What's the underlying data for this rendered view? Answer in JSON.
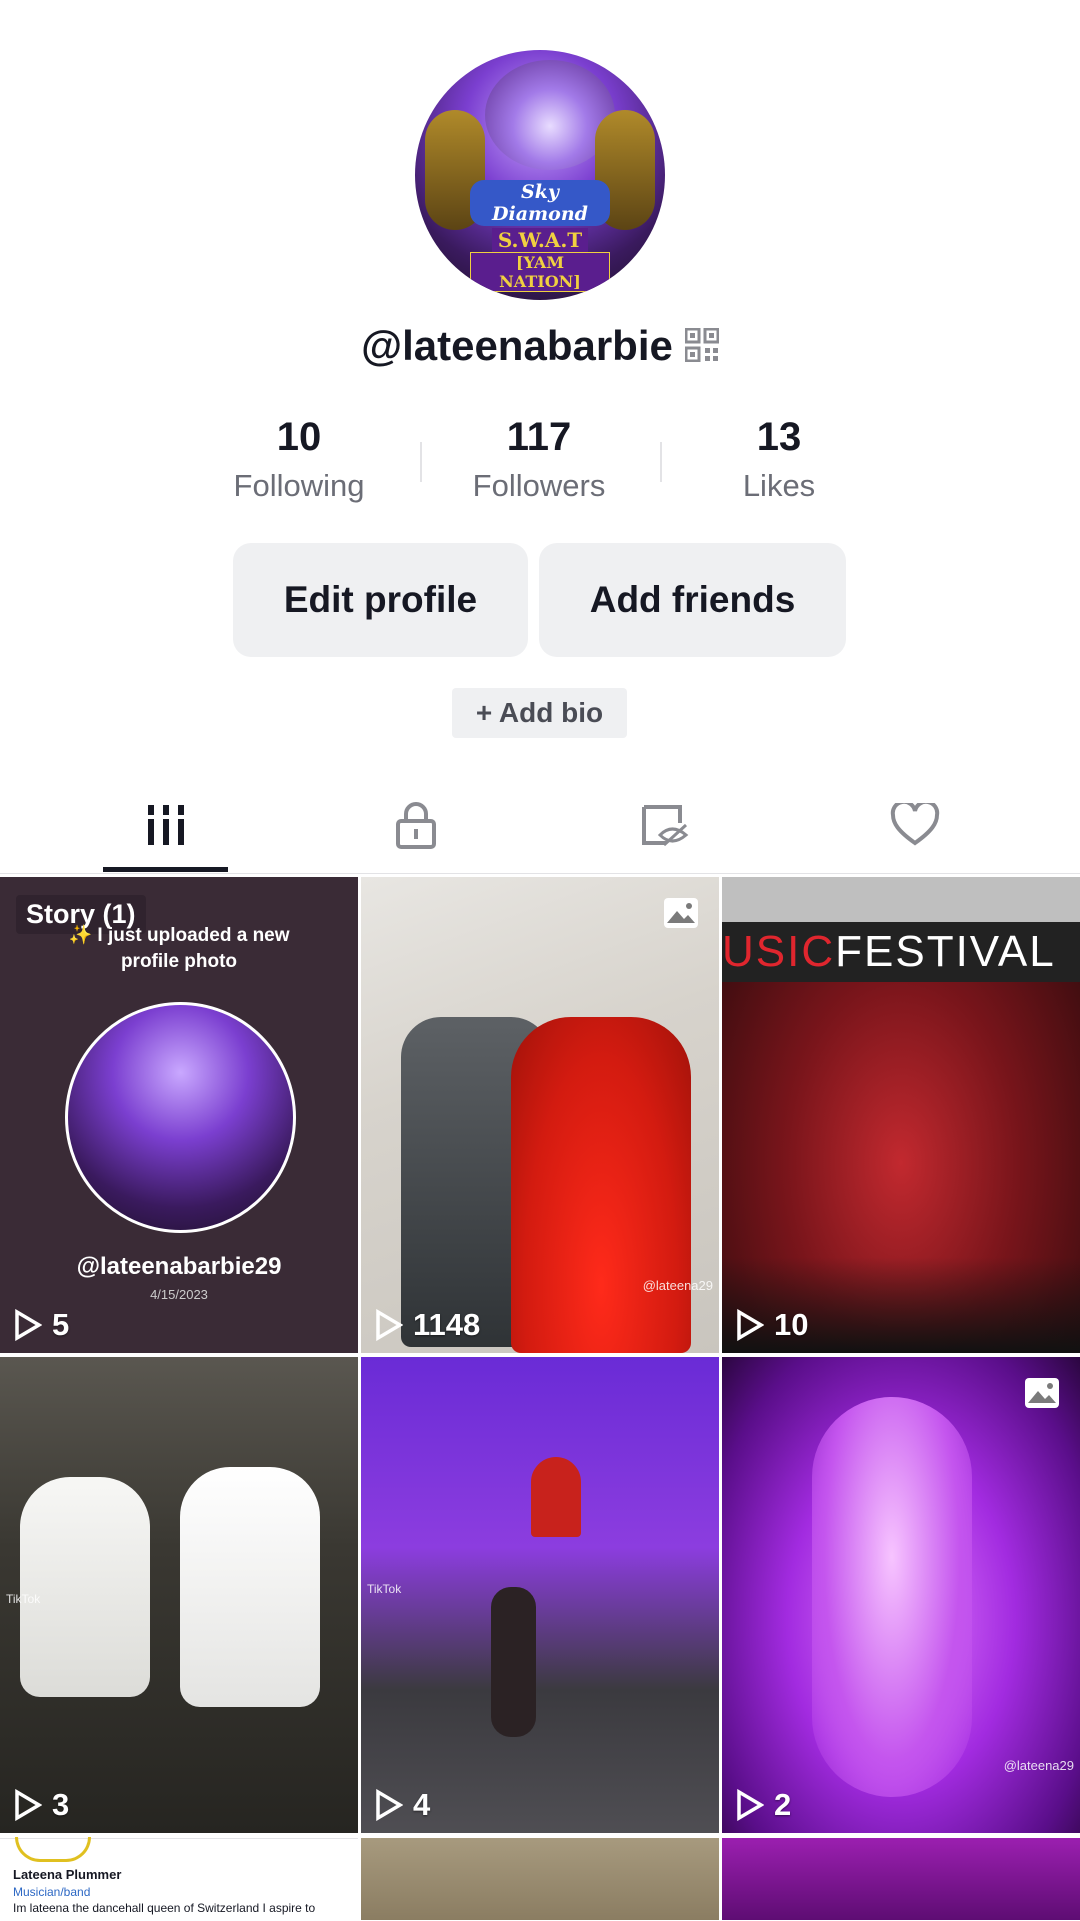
{
  "profile": {
    "username": "@lateenabarbie",
    "avatar_text": {
      "line1": "Sky Diamond",
      "line2": "S.W.A.T",
      "line3": "[YAM NATION]"
    }
  },
  "stats": [
    {
      "value": "10",
      "label": "Following"
    },
    {
      "value": "117",
      "label": "Followers"
    },
    {
      "value": "13",
      "label": "Likes"
    }
  ],
  "buttons": {
    "edit_profile": "Edit profile",
    "add_friends": "Add friends",
    "add_bio": "+ Add bio"
  },
  "tabs": [
    {
      "icon": "grid-icon",
      "active": true
    },
    {
      "icon": "lock-icon",
      "active": false
    },
    {
      "icon": "hidden-icon",
      "active": false
    },
    {
      "icon": "heart-icon",
      "active": false
    }
  ],
  "videos": [
    {
      "plays": "5",
      "story_label": "Story (1)",
      "story_text_1": "✨ I just uploaded a new",
      "story_text_2": "profile photo",
      "story_handle": "@lateenabarbie29",
      "story_date": "4/15/2023"
    },
    {
      "plays": "1148",
      "watermark": "@lateena29",
      "photo": true
    },
    {
      "plays": "10",
      "banner": "USICFESTIVAL"
    },
    {
      "plays": "3",
      "watermark": "TikTok"
    },
    {
      "plays": "4",
      "watermark": "TikTok"
    },
    {
      "plays": "2",
      "watermark": "@lateena29",
      "photo": true
    }
  ],
  "profile_card": {
    "name": "Lateena Plummer",
    "category": "Musician/band",
    "description": "Im lateena the dancehall queen of Switzerland I aspire to"
  },
  "colors": {
    "accent": "#161823",
    "muted": "#6b6d76",
    "button_bg": "#eff0f2"
  }
}
